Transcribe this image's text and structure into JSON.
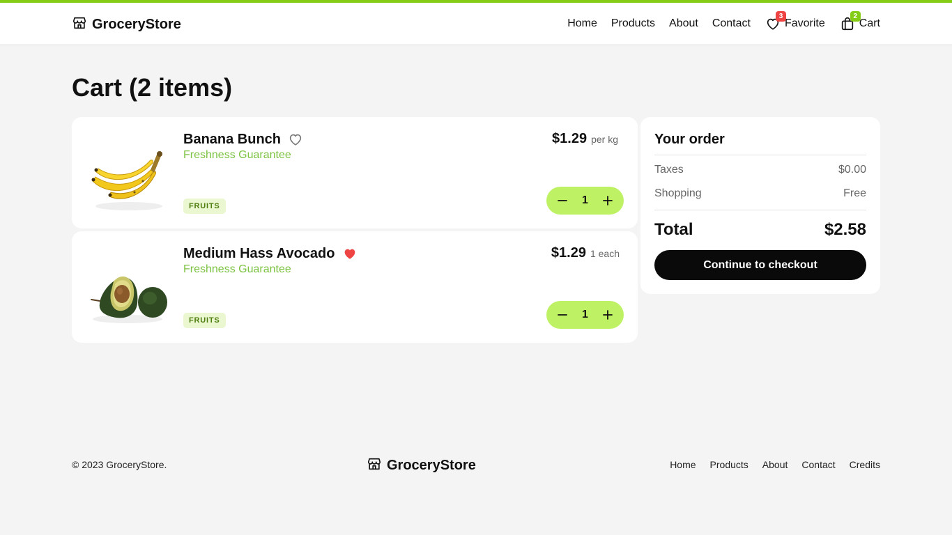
{
  "colors": {
    "accent": "#84cc16",
    "qty_bg": "#bef264",
    "subtitle_green": "#7cc241",
    "badge_red": "#ef4444",
    "checkout_bg": "#0a0a0a"
  },
  "header": {
    "brand": "GroceryStore",
    "brand_icon": "store-icon",
    "nav": [
      "Home",
      "Products",
      "About",
      "Contact"
    ],
    "favorite": {
      "label": "Favorite",
      "count": "3",
      "icon": "heart-icon"
    },
    "cart": {
      "label": "Cart",
      "count": "2",
      "icon": "shopping-bag-icon"
    }
  },
  "page": {
    "title_bold": "Cart",
    "title_count": "(2 items)"
  },
  "cart_items": [
    {
      "name": "Banana Bunch",
      "subtitle": "Freshness Guarantee",
      "price": "$1.29",
      "unit": "per kg",
      "category": "FRUITS",
      "quantity": "1",
      "favorited": false,
      "image": "banana-image"
    },
    {
      "name": "Medium Hass Avocado",
      "subtitle": "Freshness Guarantee",
      "price": "$1.29",
      "unit": "1 each",
      "category": "FRUITS",
      "quantity": "1",
      "favorited": true,
      "image": "avocado-image"
    }
  ],
  "order": {
    "title": "Your order",
    "rows": [
      {
        "label": "Taxes",
        "value": "$0.00"
      },
      {
        "label": "Shopping",
        "value": "Free"
      }
    ],
    "total_label": "Total",
    "total_value": "$2.58",
    "checkout_label": "Continue to checkout"
  },
  "footer": {
    "copyright": "© 2023 GroceryStore.",
    "brand": "GroceryStore",
    "links": [
      "Home",
      "Products",
      "About",
      "Contact",
      "Credits"
    ]
  }
}
